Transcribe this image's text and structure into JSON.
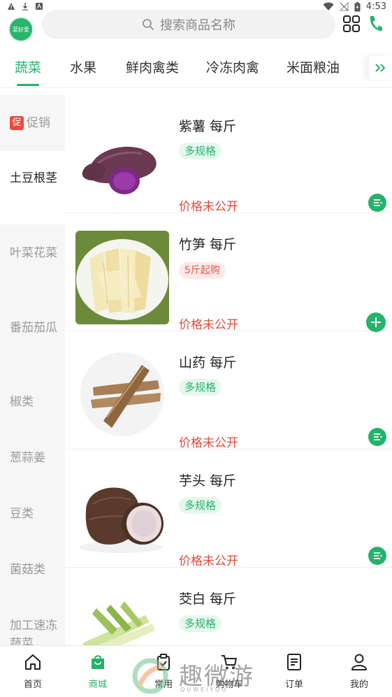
{
  "status_bar": {
    "time": "4:53"
  },
  "header": {
    "logo_text": "菜好爱",
    "search_placeholder": "搜索商品名称"
  },
  "category_tabs": [
    {
      "label": "蔬菜",
      "active": true
    },
    {
      "label": "水果",
      "active": false
    },
    {
      "label": "鲜肉禽类",
      "active": false
    },
    {
      "label": "冷冻肉禽",
      "active": false
    },
    {
      "label": "米面粮油",
      "active": false
    }
  ],
  "sidebar": {
    "promo_badge": "促",
    "items": [
      {
        "label": "促销",
        "active": false
      },
      {
        "label": "土豆根茎",
        "active": true
      },
      {
        "label": "叶菜花菜",
        "active": false
      },
      {
        "label": "番茄茄瓜",
        "active": false
      },
      {
        "label": "椒类",
        "active": false
      },
      {
        "label": "葱蒜姜",
        "active": false
      },
      {
        "label": "豆类",
        "active": false
      },
      {
        "label": "菌菇类",
        "active": false
      },
      {
        "label": "加工速冻蔬菜",
        "active": false
      }
    ]
  },
  "products": [
    {
      "name": "紫薯 每斤",
      "tag": "多规格",
      "tag_style": "green",
      "price": "价格未公开",
      "action": "list-icon"
    },
    {
      "name": "竹笋 每斤",
      "tag": "5斤起购",
      "tag_style": "red",
      "price": "价格未公开",
      "action": "plus-icon"
    },
    {
      "name": "山药 每斤",
      "tag": "多规格",
      "tag_style": "green",
      "price": "价格未公开",
      "action": "list-icon"
    },
    {
      "name": "芋头 每斤",
      "tag": "多规格",
      "tag_style": "green",
      "price": "价格未公开",
      "action": "list-icon"
    },
    {
      "name": "茭白 每斤",
      "tag": "多规格",
      "tag_style": "green",
      "price": "",
      "action": ""
    }
  ],
  "bottom_nav": [
    {
      "label": "首页",
      "icon": "home-icon",
      "active": false
    },
    {
      "label": "商城",
      "icon": "shopping-bag-icon",
      "active": true
    },
    {
      "label": "常用",
      "icon": "clipboard-icon",
      "active": false
    },
    {
      "label": "购物车",
      "icon": "cart-icon",
      "active": false
    },
    {
      "label": "订单",
      "icon": "document-icon",
      "active": false
    },
    {
      "label": "我的",
      "icon": "user-icon",
      "active": false
    }
  ],
  "watermark": {
    "text": "趣微游",
    "sub": "QUWEIYOU"
  },
  "colors": {
    "accent": "#27b26b",
    "price": "#e24a3c",
    "promo": "#e94c3d"
  }
}
